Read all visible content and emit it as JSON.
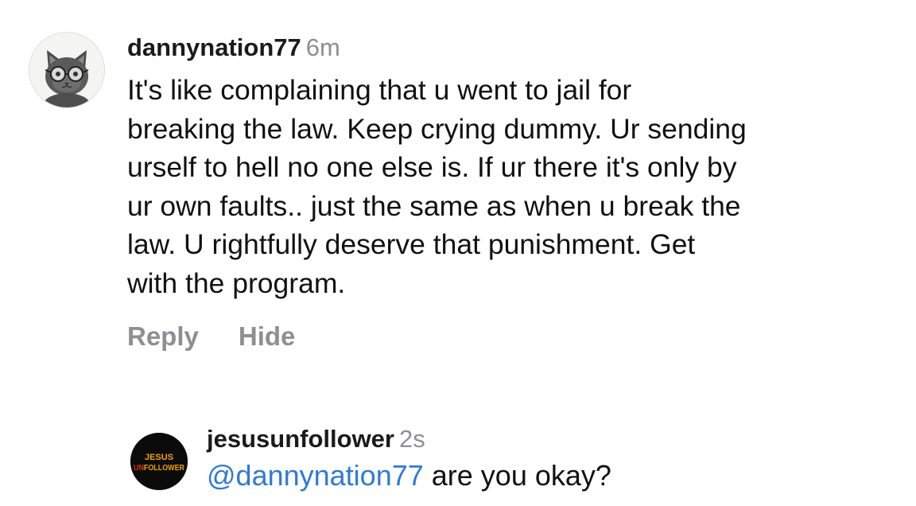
{
  "comments": [
    {
      "username": "dannynation77",
      "time": "6m",
      "avatar_icon": "cat-with-glasses-icon",
      "lines": [
        "It's like complaining that u went to jail for",
        "breaking the law. Keep crying dummy. Ur sending",
        "urself to hell no one else is. If ur there it's only by",
        "ur own faults.. just the same as when u break the",
        "law. U rightfully deserve that punishment. Get",
        "with the program."
      ],
      "actions": {
        "reply": "Reply",
        "hide": "Hide"
      }
    },
    {
      "username": "jesusunfollower",
      "time": "2s",
      "avatar_icon": "jesus-unfollower-logo",
      "avatar_logo_text": [
        "JESUS",
        "UNFOLLOWER"
      ],
      "mention": "@dannynation77",
      "text": " are you okay?"
    }
  ],
  "colors": {
    "username": "#1a1a1a",
    "meta": "#8e8e93",
    "mention": "#2f7ad4",
    "logo_text": "#f2a100",
    "logo_accent": "#e0321c"
  }
}
